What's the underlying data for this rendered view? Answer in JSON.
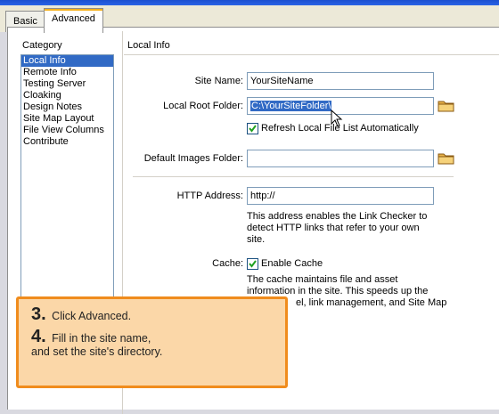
{
  "tabs": [
    {
      "label": "Basic",
      "active": false
    },
    {
      "label": "Advanced",
      "active": true
    }
  ],
  "category": {
    "title": "Category",
    "items": [
      {
        "label": "Local Info",
        "selected": true
      },
      {
        "label": "Remote Info",
        "selected": false
      },
      {
        "label": "Testing Server",
        "selected": false
      },
      {
        "label": "Cloaking",
        "selected": false
      },
      {
        "label": "Design Notes",
        "selected": false
      },
      {
        "label": "Site Map Layout",
        "selected": false
      },
      {
        "label": "File View Columns",
        "selected": false
      },
      {
        "label": "Contribute",
        "selected": false
      }
    ]
  },
  "local_info": {
    "title": "Local Info",
    "site_name_label": "Site Name:",
    "site_name_value": "YourSiteName",
    "local_root_label": "Local Root Folder:",
    "local_root_value": "C:\\YourSiteFolder\\",
    "refresh_label": "Refresh Local File List Automatically",
    "refresh_checked": true,
    "default_images_label": "Default Images Folder:",
    "default_images_value": "",
    "http_label": "HTTP Address:",
    "http_value": "http://",
    "http_help": [
      "This address enables the Link Checker to",
      "detect HTTP links that refer to your own",
      "site."
    ],
    "cache_label": "Cache:",
    "cache_checkbox_label": "Enable Cache",
    "cache_checked": true,
    "cache_help": [
      "The cache maintains file and asset",
      "information in the site.  This speeds up the",
      "el, link management, and Site Map"
    ]
  },
  "callout": {
    "step3_num": "3.",
    "step3_text": "Click Advanced.",
    "step4_num": "4.",
    "step4_text": "Fill in the site name,",
    "step4_text2": "and set the site's directory."
  },
  "icons": {
    "folder": "folder-icon",
    "checkmark": "checkmark-icon",
    "cursor": "mouse-cursor-icon",
    "logo": "e-logo-icon"
  },
  "colors": {
    "selection": "#316ac5",
    "tab_accent": "#f7b21c",
    "callout_fill": "#fbd7a8",
    "callout_border": "#f08c1d",
    "titlebar": "#2a63e6"
  }
}
